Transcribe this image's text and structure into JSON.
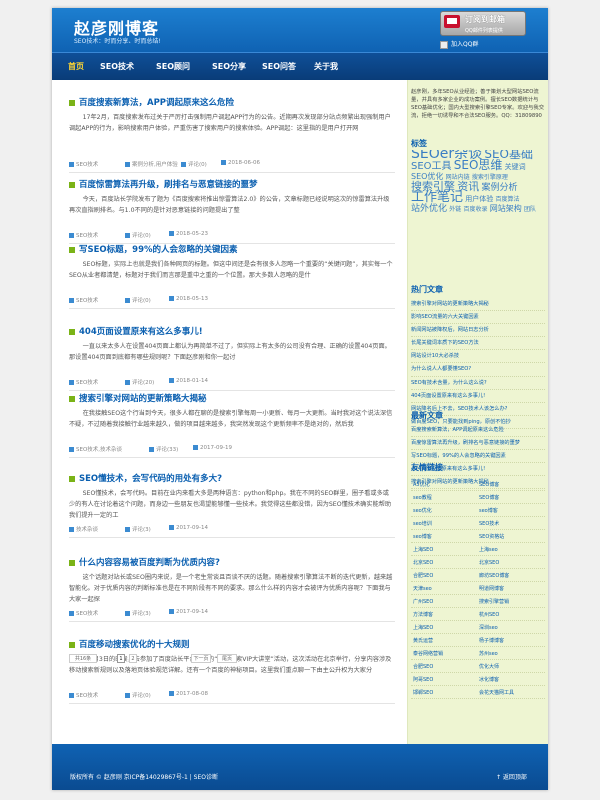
{
  "header": {
    "title": "赵彦刚博客",
    "subtitle": "SEO技术：时而分享、时而总结!",
    "subscribe_title": "订阅到邮箱",
    "subscribe_sub": "QQ邮件列表提供",
    "qq_group": "加入QQ群"
  },
  "nav": [
    "首页",
    "SEO技术",
    "SEO顾问",
    "SEO分享",
    "SEO问答",
    "关于我"
  ],
  "posts": [
    {
      "title": "百度搜索新算法，APP调起原来这么危险",
      "summary": "17年2月，百度搜索发布过关于严厉打击强制用户调起APP行为的公告。近期再次发现部分站点频繁出现强制用户调起APP的行为，影响搜索用户体验，严重伤害了搜索用户的搜索体验。APP调起：这里指的是用户打开网",
      "category": "SEO技术",
      "tags": "案例分析,用户体验",
      "comments": "评论(0)",
      "date": "2018-06-06"
    },
    {
      "title": "百度惊雷算法再升级，刷排名与恶意链接的噩梦",
      "summary": "今天，百度站长学院发布了题为《百度搜索将推出惊雷算法2.0》的公告，文章标题已经说明这次的惊雷算法升级再次直指刷排名。与1.0不同的是针对恶意链接的问题提出了整",
      "category": "SEO技术",
      "tags": "",
      "comments": "评论(0)",
      "date": "2018-05-23"
    },
    {
      "title": "写SEO标题，99%的人会忽略的关键因素",
      "summary": "SEO标题，实际上也就是我们各种网页的标题。但这中间还是会有很多人忽略一个重要的“关键问题”，其实每一个SEO从业者都清楚，标题对于我们而言那是重中之重的一个位置。那大多数人忽略的是什",
      "category": "SEO技术",
      "tags": "",
      "comments": "评论(0)",
      "date": "2018-05-13"
    },
    {
      "title": "404页面设置原来有这么多事儿!",
      "summary": "一直以来太多人在设置404页面上都认为再简单不过了，但实际上有太多的公司没有合理、正确的设置404页面。那设置404页面到底都有哪些规则呢？下面赵彦刚和你一起讨",
      "category": "SEO技术",
      "tags": "",
      "comments": "评论(20)",
      "date": "2018-01-14"
    },
    {
      "title": "搜索引擎对网站的更新策略大揭秘",
      "summary": "在我接触SEO这个行当到今天，很多人都在聊的是搜索引擎每周一小更新、每月一大更新。当时我对这个说法深信不疑，不过随着我接触行业越来越久，做的项目越来越多，我突然发现这个更新频率不是绝对的，然后我",
      "category": "SEO技术,技术杂谈",
      "tags": "",
      "comments": "评论(33)",
      "date": "2017-09-19"
    },
    {
      "title": "SEO懂技术，会写代码的用处有多大?",
      "summary": "SEO懂技术，会写代码。目前在业内来看大多是两种语言：python和php。我在不同的SEO群里，圈子看或多或少的有人在讨论着这个问题，而身边一些朋友也渴望能够懂一些技术。我觉得这些都没错，因为SEO懂技术确实能帮助我们提升一定的工",
      "category": "技术杂谈",
      "tags": "",
      "comments": "评论(3)",
      "date": "2017-09-14"
    },
    {
      "title": "什么内容容易被百度判断为优质内容?",
      "summary": "这个话题对站长或SEO圈内来说，是一个老生常谈且百谈不厌的话题。随着搜索引擎算法不断的迭代更新，越来越智能化。对于优质内容的判断标准也是在不同阶段有不同的要求。那么什么样的内容才会被评为优质内容呢？下面我与大家一起探",
      "category": "SEO技术",
      "tags": "",
      "comments": "评论(3)",
      "date": "2017-09-14"
    },
    {
      "title": "百度移动搜索优化的十大规则",
      "summary": "在8月3日的时候，去参加了百度站长平台举办的“百度搜索VIP大讲堂”活动，这次活动在北京举行，分享内容涉及移动搜索新规则以及落地页体验规范详解。还有一个百度的神秘项目。这里我们重点聊一下由主公升权为大家分",
      "category": "SEO技术",
      "tags": "",
      "comments": "评论(0)",
      "date": "2017-08-08"
    }
  ],
  "pager": [
    "共16条",
    "1",
    "2",
    "下一页",
    "尾页"
  ],
  "sidebar": {
    "intro": "赵彦刚，多年SEO从业经验；善于策划大型网站SEO流量，并具有多家企业的成功案例。擅长SEO数据统计与SEO基础优化；国内大型搜索引擎SEO专家。欢迎与我交流，拒绝一切诱导和不合法SEO服务。QQ：31809890",
    "tags_title": "标签",
    "tags": [
      {
        "t": "SEOer杂谈",
        "s": 14
      },
      {
        "t": "SEO基础",
        "s": 12
      },
      {
        "t": "SEO工具",
        "s": 10
      },
      {
        "t": "SEO思维",
        "s": 12
      },
      {
        "t": "关键词",
        "s": 7
      },
      {
        "t": "SEO优化",
        "s": 8
      },
      {
        "t": "网站内链",
        "s": 6
      },
      {
        "t": "搜索引擎原理",
        "s": 6
      },
      {
        "t": "搜索引擎",
        "s": 11
      },
      {
        "t": "资讯",
        "s": 11
      },
      {
        "t": "案例分析",
        "s": 9
      },
      {
        "t": "工作笔记",
        "s": 13
      },
      {
        "t": "用户体验",
        "s": 7
      },
      {
        "t": "百度算法",
        "s": 6
      },
      {
        "t": "站外优化",
        "s": 9
      },
      {
        "t": "外链",
        "s": 6
      },
      {
        "t": "百度收录",
        "s": 6
      },
      {
        "t": "网站架构",
        "s": 8
      },
      {
        "t": "团队",
        "s": 6
      }
    ],
    "hot_title": "热门文章",
    "hot": [
      "搜索引擎对网站的更新策略大揭秘",
      "影响SEO流量的六大关键因素",
      "新闻网站被降权后，网站日志分析",
      "长尾关键词本质下的SEO方法",
      "网站设计10大必杀技",
      "为什么说人人都要懂SEO?",
      "SEO有技术含量，为什么这么说?",
      "404页面设置原来有这么多事儿!",
      "网站降名后上不去，SEO技术人该怎么办?",
      "做百度SEO，只要能找到ping，原创不怕抄"
    ],
    "new_title": "最新文章",
    "new": [
      "百度搜索新算法，APP调起原来这么危险",
      "百度惊雷算法再升级，刷排名与恶意链接的噩梦",
      "写SEO标题，99%的人会忽略的关键因素",
      "404页面设置原来有这么多事儿!",
      "搜索引擎对网站的更新策略大揭秘"
    ],
    "links_title": "友情链接",
    "links": [
      [
        "A5优化",
        "SEO博客"
      ],
      [
        "seo教程",
        "SEO博客"
      ],
      [
        "seo优化",
        "seo博客"
      ],
      [
        "seo培训",
        "SEO技术"
      ],
      [
        "seo博客",
        "SEO资格站"
      ],
      [
        "上海SEO",
        "上海seo"
      ],
      [
        "北京SEO",
        "北京SEO"
      ],
      [
        "合肥SEO",
        "廊坊SEO博客"
      ],
      [
        "天津seo",
        "明道网博客"
      ],
      [
        "广州SEO",
        "搜索引擎营销"
      ],
      [
        "方法博客",
        "杭州SEO"
      ],
      [
        "上海SEO",
        "深圳seo"
      ],
      [
        "黄氏运营",
        "杨子博博客"
      ],
      [
        "泰谷网络营销",
        "苏州seo"
      ],
      [
        "合肥SEO",
        "优化大师"
      ],
      [
        "阿哥SEO",
        "冰化博客"
      ],
      [
        "邯郸SEO",
        "会花天猫网工具"
      ]
    ]
  },
  "footer": {
    "text": "版权所有 © 赵彦刚 京ICP备14029867号-1 | SEO诊断",
    "top": "↑ 返回顶部"
  }
}
